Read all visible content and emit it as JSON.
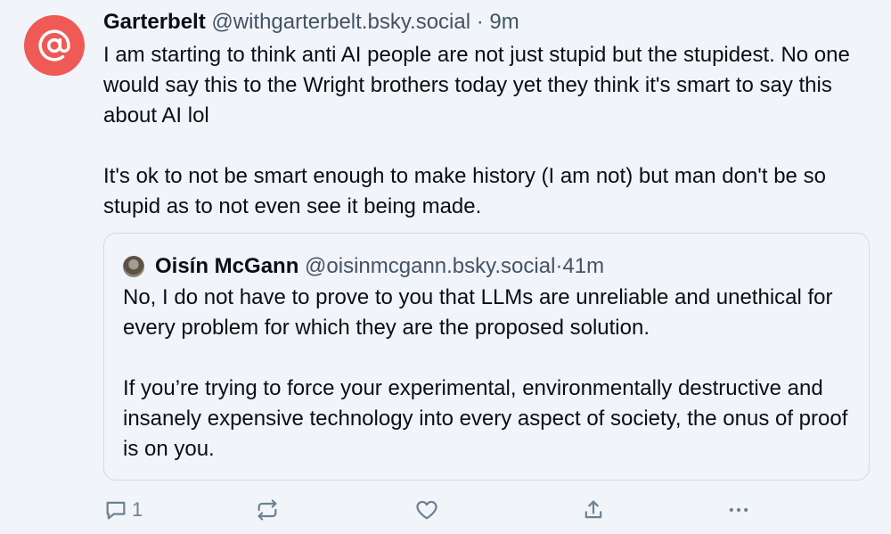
{
  "author": {
    "display_name": "Garterbelt",
    "handle": "@withgarterbelt.bsky.social",
    "separator": " · ",
    "time": "9m",
    "avatar_icon": "at-sign-icon",
    "avatar_color": "#ef5a56"
  },
  "post": {
    "paragraphs": [
      "I am starting to think anti AI people are not just stupid but the stupidest. No one would say this to the Wright brothers today yet they think it's smart to say this about AI lol",
      "It's ok to not be smart enough to make history (I am not) but man don't be so stupid as to not even see it being made."
    ]
  },
  "quote": {
    "display_name": "Oisín McGann",
    "handle": "@oisinmcgann.bsky.social",
    "separator": " · ",
    "time": "41m",
    "paragraphs": [
      "No, I do not have to prove to you that LLMs are unreliable and unethical for every problem for which they are the proposed solution.",
      "If you’re trying to force your experimental, environmentally destructive and insanely expensive technology into every aspect of society, the onus of proof is on you."
    ]
  },
  "actions": {
    "reply_count": "1",
    "icons": [
      "reply-icon",
      "repost-icon",
      "like-icon",
      "share-icon",
      "more-icon"
    ],
    "icon_color": "#6e8193"
  }
}
